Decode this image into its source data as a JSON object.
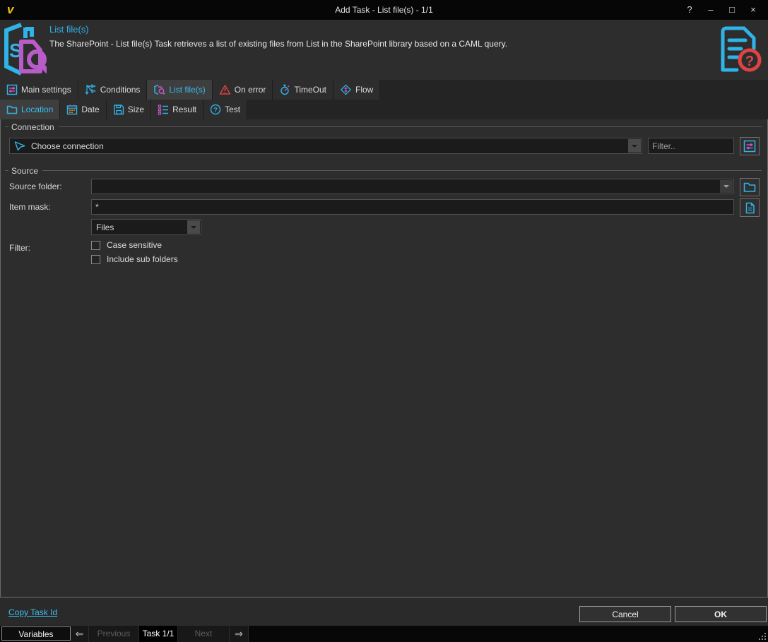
{
  "window": {
    "logo": "v",
    "title": "Add Task - List file(s) - 1/1",
    "controls": {
      "help": "?",
      "minimize": "–",
      "maximize": "□",
      "close": "×"
    }
  },
  "header": {
    "title": "List file(s)",
    "description": "The SharePoint - List file(s) Task retrieves a list of existing files from List in the SharePoint library based on a CAML query."
  },
  "tabs_main": [
    {
      "label": "Main settings",
      "icon": "settings-sliders-icon",
      "active": false
    },
    {
      "label": "Conditions",
      "icon": "conditions-branch-icon",
      "active": false
    },
    {
      "label": "List file(s)",
      "icon": "sharepoint-list-icon",
      "active": true
    },
    {
      "label": "On error",
      "icon": "error-triangle-icon",
      "active": false
    },
    {
      "label": "TimeOut",
      "icon": "stopwatch-icon",
      "active": false
    },
    {
      "label": "Flow",
      "icon": "flow-diamond-icon",
      "active": false
    }
  ],
  "tabs_sub": [
    {
      "label": "Location",
      "icon": "folder-icon",
      "active": true
    },
    {
      "label": "Date",
      "icon": "calendar-icon",
      "active": false
    },
    {
      "label": "Size",
      "icon": "floppy-disk-icon",
      "active": false
    },
    {
      "label": "Result",
      "icon": "result-list-icon",
      "active": false
    },
    {
      "label": "Test",
      "icon": "question-circle-icon",
      "active": false
    }
  ],
  "connection": {
    "group_label": "Connection",
    "dropdown_value": "Choose connection",
    "filter_placeholder": "Filter.."
  },
  "source": {
    "group_label": "Source",
    "source_folder_label": "Source folder:",
    "source_folder_value": "",
    "item_mask_label": "Item mask:",
    "item_mask_value": "*",
    "type_dropdown_value": "Files",
    "filter_label": "Filter:",
    "checkboxes": [
      {
        "label": "Case sensitive",
        "checked": false
      },
      {
        "label": "Include sub folders",
        "checked": false
      }
    ]
  },
  "footer": {
    "copy_task_id_link": "Copy Task Id",
    "cancel_label": "Cancel",
    "ok_label": "OK"
  },
  "bottom_bar": {
    "variables_label": "Variables",
    "previous_arrow": "⇐",
    "previous_label": "Previous",
    "task_counter": "Task 1/1",
    "next_label": "Next",
    "next_arrow": "⇒"
  },
  "colors": {
    "accent_cyan": "#2fb3e8",
    "accent_magenta": "#c45ac4",
    "error_red": "#e04343",
    "logo_yellow": "#f2c21a",
    "panel_background": "#2d2d2d",
    "input_background": "#1b1b1b"
  }
}
